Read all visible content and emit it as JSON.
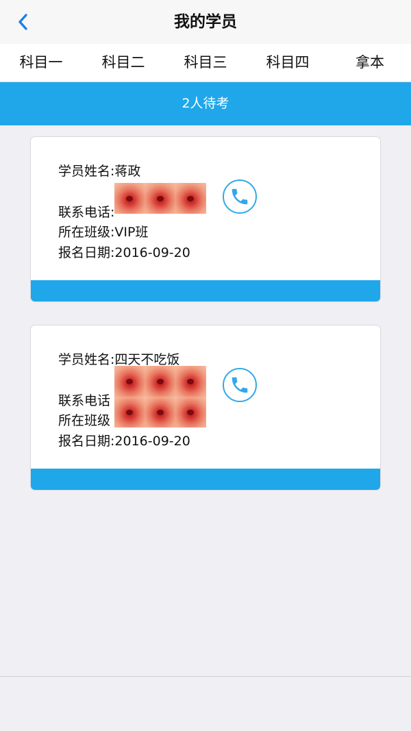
{
  "header": {
    "title": "我的学员",
    "back_icon": "chevron-left-icon"
  },
  "tabs": [
    {
      "label": "科目一"
    },
    {
      "label": "科目二"
    },
    {
      "label": "科目三"
    },
    {
      "label": "科目四"
    },
    {
      "label": "拿本"
    }
  ],
  "status": {
    "text": "2人待考"
  },
  "students": [
    {
      "name_line": "学员姓名:蒋政",
      "phone_line": "联系电话:",
      "class_line": "所在班级:VIP班",
      "date_line": "报名日期:2016-09-20"
    },
    {
      "name_line": "学员姓名:四天不吃饭",
      "phone_line": "联系电话",
      "class_line": "所在班级",
      "date_line": "报名日期:2016-09-20"
    }
  ],
  "colors": {
    "accent": "#1fa7ea",
    "call_icon": "#31a8e8",
    "background": "#efeff4"
  }
}
